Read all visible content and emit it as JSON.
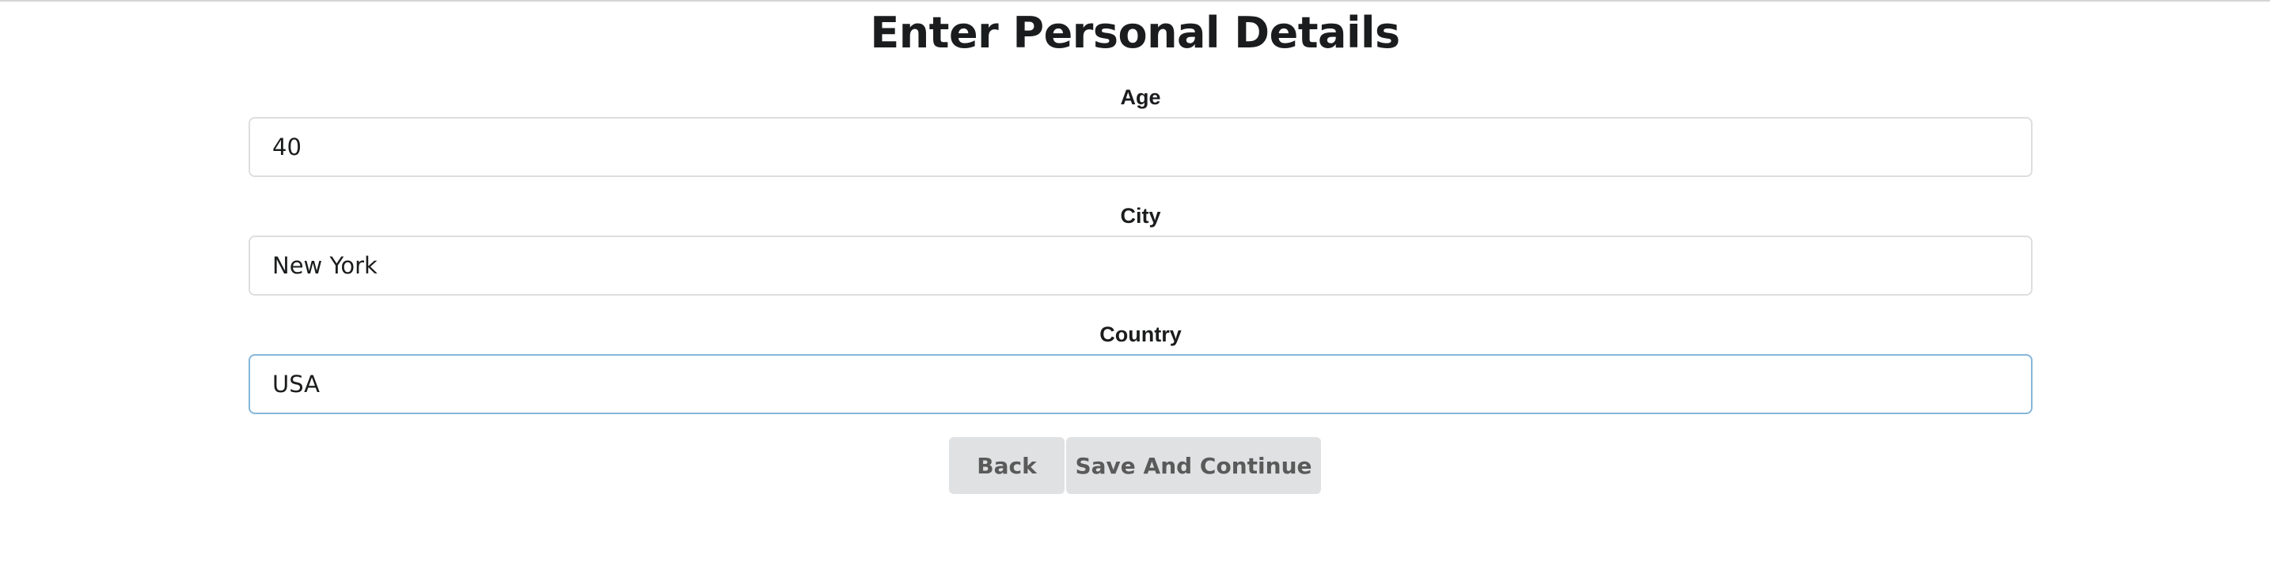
{
  "page": {
    "title": "Enter Personal Details"
  },
  "form": {
    "fields": [
      {
        "label": "Age",
        "value": "40"
      },
      {
        "label": "City",
        "value": "New York"
      },
      {
        "label": "Country",
        "value": "USA"
      }
    ],
    "focus_color": "#85b7d9"
  },
  "actions": {
    "back_label": "Back",
    "save_label": "Save And Continue",
    "button_bg": "#e0e1e2"
  }
}
